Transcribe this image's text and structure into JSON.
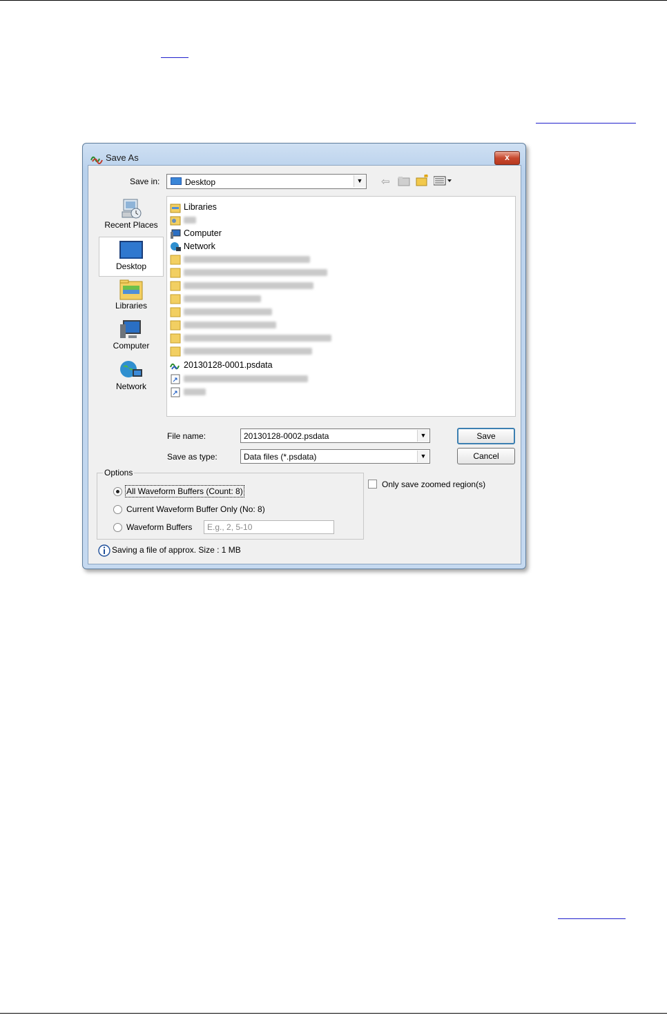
{
  "dialog": {
    "title": "Save As",
    "close_label": "x",
    "save_in": {
      "label": "Save in:",
      "value": "Desktop"
    },
    "toolbar_icons": [
      "back-arrow-icon",
      "up-folder-icon",
      "new-folder-icon",
      "view-menu-icon"
    ],
    "places": [
      {
        "label": "Recent Places",
        "icon": "recent-places-icon"
      },
      {
        "label": "Desktop",
        "icon": "desktop-icon",
        "selected": true
      },
      {
        "label": "Libraries",
        "icon": "libraries-icon"
      },
      {
        "label": "Computer",
        "icon": "computer-icon"
      },
      {
        "label": "Network",
        "icon": "network-icon"
      }
    ],
    "files": {
      "libraries": "Libraries",
      "computer": "Computer",
      "network": "Network",
      "psdata_file": "20130128-0001.psdata"
    },
    "file_name": {
      "label": "File name:",
      "value": "20130128-0002.psdata"
    },
    "save_as_type": {
      "label": "Save as type:",
      "value": "Data files (*.psdata)"
    },
    "save_button": "Save",
    "cancel_button": "Cancel",
    "options": {
      "legend": "Options",
      "all_buffers": "All Waveform Buffers (Count: 8)",
      "current_buffer": "Current Waveform Buffer Only (No: 8)",
      "waveform_buffers": "Waveform Buffers",
      "buffers_placeholder": "E.g., 2, 5-10",
      "selected": "all_buffers"
    },
    "zoomed_label": "Only save zoomed region(s)",
    "status_text": "Saving a file of approx. Size : 1 MB"
  }
}
